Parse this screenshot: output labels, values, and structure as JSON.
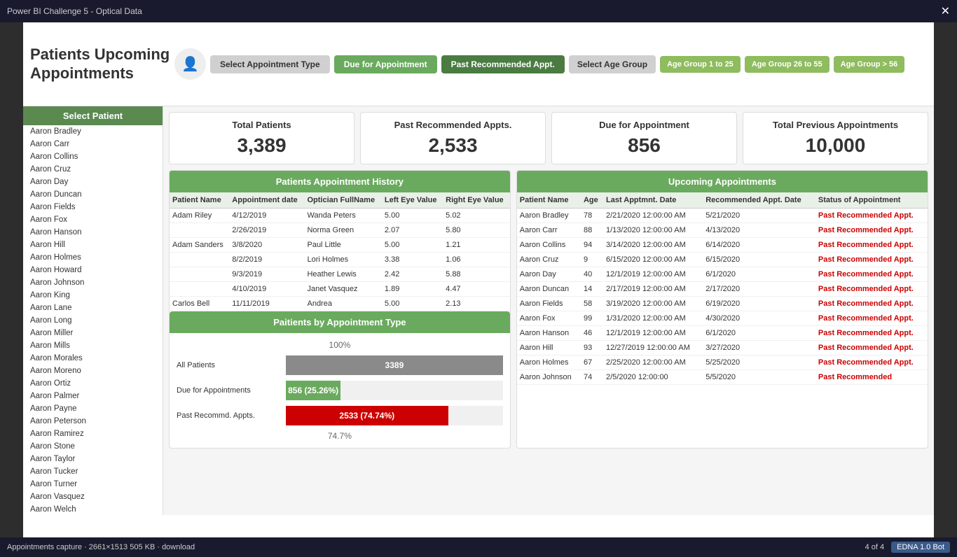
{
  "topbar": {
    "title": "Power BI Challenge 5 - Optical Data",
    "close_label": "✕"
  },
  "header": {
    "title_line1": "Patients Upcoming",
    "title_line2": "Appointments",
    "icon": "👤",
    "btn_select_appt": "Select Appointment Type",
    "btn_due": "Due for Appointment",
    "btn_past": "Past Recommended Appt.",
    "btn_select_age": "Select Age Group",
    "btn_age1": "Age Group 1 to 25",
    "btn_age2": "Age Group 26 to 55",
    "btn_age3": "Age Group > 56"
  },
  "sidebar": {
    "header": "Select Patient",
    "items": [
      "Aaron Bradley",
      "Aaron Carr",
      "Aaron Collins",
      "Aaron Cruz",
      "Aaron Day",
      "Aaron Duncan",
      "Aaron Fields",
      "Aaron Fox",
      "Aaron Hanson",
      "Aaron Hill",
      "Aaron Holmes",
      "Aaron Howard",
      "Aaron Johnson",
      "Aaron King",
      "Aaron Lane",
      "Aaron Long",
      "Aaron Miller",
      "Aaron Mills",
      "Aaron Morales",
      "Aaron Moreno",
      "Aaron Ortiz",
      "Aaron Palmer",
      "Aaron Payne",
      "Aaron Peterson",
      "Aaron Ramirez",
      "Aaron Stone",
      "Aaron Taylor",
      "Aaron Tucker",
      "Aaron Turner",
      "Aaron Vasquez",
      "Aaron Welch"
    ]
  },
  "stats": {
    "total_patients_label": "Total Patients",
    "total_patients_value": "3,389",
    "past_recommended_label": "Past Recommended Appts.",
    "past_recommended_value": "2,533",
    "due_label": "Due for Appointment",
    "due_value": "856",
    "total_prev_label": "Total Previous Appointments",
    "total_prev_value": "10,000"
  },
  "appointment_history": {
    "title": "Patients Appointment History",
    "columns": [
      "Patient Name",
      "Appointment date",
      "Optician FullName",
      "Left Eye Value",
      "Right Eye Value"
    ],
    "rows": [
      {
        "name": "Adam Riley",
        "date": "4/12/2019",
        "optician": "Wanda Peters",
        "left": "5.00",
        "right": "5.02"
      },
      {
        "name": "",
        "date": "2/26/2019",
        "optician": "Norma Green",
        "left": "2.07",
        "right": "5.80"
      },
      {
        "name": "Adam Sanders",
        "date": "3/8/2020",
        "optician": "Paul Little",
        "left": "5.00",
        "right": "1.21"
      },
      {
        "name": "",
        "date": "8/2/2019",
        "optician": "Lori Holmes",
        "left": "3.38",
        "right": "1.06"
      },
      {
        "name": "",
        "date": "9/3/2019",
        "optician": "Heather Lewis",
        "left": "2.42",
        "right": "5.88"
      },
      {
        "name": "",
        "date": "4/10/2019",
        "optician": "Janet Vasquez",
        "left": "1.89",
        "right": "4.47"
      },
      {
        "name": "Carlos Bell",
        "date": "11/11/2019",
        "optician": "Andrea",
        "left": "5.00",
        "right": "2.13"
      }
    ]
  },
  "upcoming_appointments": {
    "title": "Upcoming Appointments",
    "columns": [
      "Patient Name",
      "Age",
      "Last Apptmnt. Date",
      "Recommended Appt. Date",
      "Status of Appointment"
    ],
    "rows": [
      {
        "name": "Aaron Bradley",
        "age": "78",
        "last": "2/21/2020 12:00:00 AM",
        "recommended": "5/21/2020",
        "status": "Past Recommended Appt."
      },
      {
        "name": "Aaron Carr",
        "age": "88",
        "last": "1/13/2020 12:00:00 AM",
        "recommended": "4/13/2020",
        "status": "Past Recommended Appt."
      },
      {
        "name": "Aaron Collins",
        "age": "94",
        "last": "3/14/2020 12:00:00 AM",
        "recommended": "6/14/2020",
        "status": "Past Recommended Appt."
      },
      {
        "name": "Aaron Cruz",
        "age": "9",
        "last": "6/15/2020 12:00:00 AM",
        "recommended": "6/15/2020",
        "status": "Past Recommended Appt."
      },
      {
        "name": "Aaron Day",
        "age": "40",
        "last": "12/1/2019 12:00:00 AM",
        "recommended": "6/1/2020",
        "status": "Past Recommended Appt."
      },
      {
        "name": "Aaron Duncan",
        "age": "14",
        "last": "2/17/2019 12:00:00 AM",
        "recommended": "2/17/2020",
        "status": "Past Recommended Appt."
      },
      {
        "name": "Aaron Fields",
        "age": "58",
        "last": "3/19/2020 12:00:00 AM",
        "recommended": "6/19/2020",
        "status": "Past Recommended Appt."
      },
      {
        "name": "Aaron Fox",
        "age": "99",
        "last": "1/31/2020 12:00:00 AM",
        "recommended": "4/30/2020",
        "status": "Past Recommended Appt."
      },
      {
        "name": "Aaron Hanson",
        "age": "46",
        "last": "12/1/2019 12:00:00 AM",
        "recommended": "6/1/2020",
        "status": "Past Recommended Appt."
      },
      {
        "name": "Aaron Hill",
        "age": "93",
        "last": "12/27/2019 12:00:00 AM",
        "recommended": "3/27/2020",
        "status": "Past Recommended Appt."
      },
      {
        "name": "Aaron Holmes",
        "age": "67",
        "last": "2/25/2020 12:00:00 AM",
        "recommended": "5/25/2020",
        "status": "Past Recommended Appt."
      },
      {
        "name": "Aaron Johnson",
        "age": "74",
        "last": "2/5/2020 12:00:00",
        "recommended": "5/5/2020",
        "status": "Past Recommended"
      }
    ]
  },
  "chart": {
    "title": "Paitients by Appointment Type",
    "pct_100": "100%",
    "pct_74": "74.7%",
    "bars": [
      {
        "label": "All Patients",
        "value": "3389",
        "pct": 100,
        "color": "gray"
      },
      {
        "label": "Due for Appointments",
        "value": "856 (25.26%)",
        "pct": 25.26,
        "color": "green"
      },
      {
        "label": "Past Recommd. Appts.",
        "value": "2533 (74.74%)",
        "pct": 74.74,
        "color": "red"
      }
    ]
  },
  "footer": {
    "file_info": "Appointments capture · 2661×1513 505 KB · download",
    "page_info": "4 of 4",
    "edna_label": "EDNA 1.0 Bot"
  }
}
